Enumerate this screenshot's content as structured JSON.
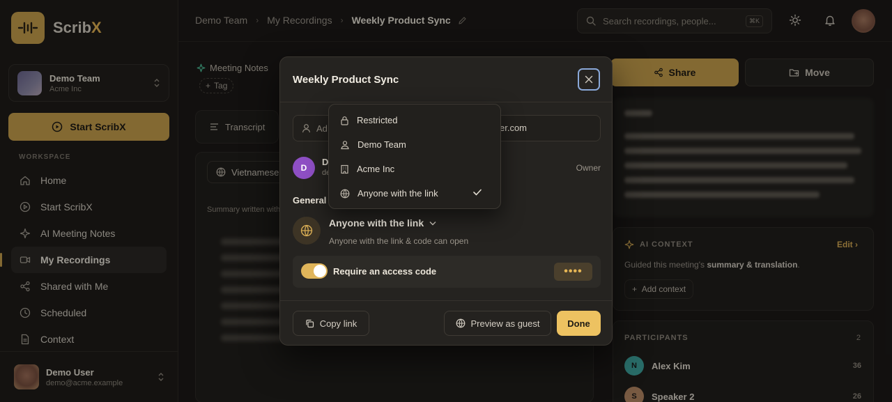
{
  "app": {
    "logo_text_a": "Scrib",
    "logo_text_b": "X",
    "accent": "#c9a14e"
  },
  "sidebar": {
    "team_name": "Demo Team",
    "team_org": "Acme Inc",
    "start_label": "Start ScribX",
    "section_label": "WORKSPACE",
    "items": [
      {
        "label": "Home",
        "icon": "home-icon"
      },
      {
        "label": "Start ScribX",
        "icon": "play-circle-icon"
      },
      {
        "label": "AI Meeting Notes",
        "icon": "sparkle-icon"
      },
      {
        "label": "My Recordings",
        "icon": "video-icon",
        "active": true
      },
      {
        "label": "Shared with Me",
        "icon": "share-icon"
      },
      {
        "label": "Scheduled",
        "icon": "clock-icon"
      },
      {
        "label": "Context",
        "icon": "document-icon"
      }
    ],
    "user_name": "Demo User",
    "user_email": "demo@acme.example"
  },
  "topbar": {
    "breadcrumb": [
      "Demo Team",
      "My Recordings",
      "Weekly Product Sync"
    ],
    "search_placeholder": "Search recordings, people...",
    "search_shortcut": "⌘K"
  },
  "main": {
    "meeting_notes_label": "Meeting Notes",
    "tag_label": "Tag",
    "transcript_label": "Transcript",
    "language": "Vietnamese",
    "summary_note": "Summary written with"
  },
  "right": {
    "share_label": "Share",
    "move_label": "Move",
    "ai_context_title": "AI CONTEXT",
    "ai_context_edit": "Edit",
    "ai_context_desc_a": "Guided this meeting's ",
    "ai_context_desc_b": "summary & translation",
    "ai_context_desc_c": ".",
    "add_context": "Add context",
    "participants_title": "PARTICIPANTS",
    "participants_count": "2",
    "participants": [
      {
        "initial": "N",
        "name": "Alex Kim",
        "count": "36",
        "color": "#3fa6a0"
      },
      {
        "initial": "S",
        "name": "Speaker 2",
        "count": "26",
        "color": "#b98a66"
      }
    ]
  },
  "modal": {
    "title": "Weekly Product Sync",
    "invite_placeholder": "Ad",
    "invite_tail": "er.com",
    "owner_initial": "D",
    "owner_name": "D",
    "owner_email": "de",
    "owner_role": "Owner",
    "general_label": "General",
    "access_value": "Anyone with the link",
    "access_desc": "Anyone with the link & code can open",
    "code_label": "Require an access code",
    "code_dots": "••••",
    "copy_link": "Copy link",
    "preview_guest": "Preview as guest",
    "done": "Done"
  },
  "dropdown": {
    "options": [
      {
        "label": "Restricted",
        "icon": "lock-icon"
      },
      {
        "label": "Demo Team",
        "icon": "users-icon"
      },
      {
        "label": "Acme Inc",
        "icon": "building-icon"
      },
      {
        "label": "Anyone with the link",
        "icon": "globe-icon",
        "selected": true
      }
    ]
  }
}
